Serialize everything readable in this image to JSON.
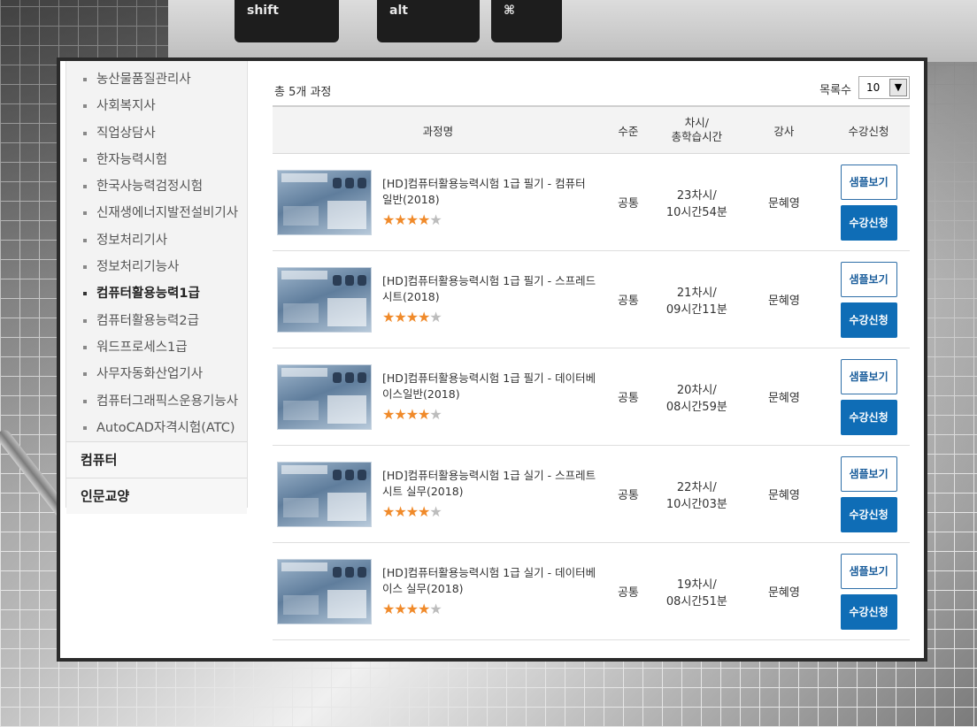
{
  "sidebar": {
    "items": [
      {
        "label": "농산물품질관리사",
        "active": false
      },
      {
        "label": "사회복지사",
        "active": false
      },
      {
        "label": "직업상담사",
        "active": false
      },
      {
        "label": "한자능력시험",
        "active": false
      },
      {
        "label": "한국사능력검정시험",
        "active": false
      },
      {
        "label": "신재생에너지발전설비기사",
        "active": false
      },
      {
        "label": "정보처리기사",
        "active": false
      },
      {
        "label": "정보처리기능사",
        "active": false
      },
      {
        "label": "컴퓨터활용능력1급",
        "active": true
      },
      {
        "label": "컴퓨터활용능력2급",
        "active": false
      },
      {
        "label": "워드프로세스1급",
        "active": false
      },
      {
        "label": "사무자동화산업기사",
        "active": false
      },
      {
        "label": "컴퓨터그래픽스운용기능사",
        "active": false
      },
      {
        "label": "AutoCAD자격시험(ATC)",
        "active": false
      }
    ],
    "categories": [
      "컴퓨터",
      "인문교양"
    ]
  },
  "main": {
    "total_text": "총 5개 과정",
    "count_label": "목록수",
    "count_value": "10",
    "columns": [
      "과정명",
      "수준",
      "차시/\n총학습시간",
      "강사",
      "수강신청"
    ],
    "courses": [
      {
        "title": "[HD]컴퓨터활용능력시험 1급 필기 - 컴퓨터 일반(2018)",
        "rating": 4.5,
        "level": "공통",
        "sessions": "23차시/",
        "duration": "10시간54분",
        "teacher": "문혜영"
      },
      {
        "title": "[HD]컴퓨터활용능력시험 1급 필기 - 스프레드시트(2018)",
        "rating": 4.5,
        "level": "공통",
        "sessions": "21차시/",
        "duration": "09시간11분",
        "teacher": "문혜영"
      },
      {
        "title": "[HD]컴퓨터활용능력시험 1급 필기 - 데이터베이스일반(2018)",
        "rating": 4.5,
        "level": "공통",
        "sessions": "20차시/",
        "duration": "08시간59분",
        "teacher": "문혜영"
      },
      {
        "title": "[HD]컴퓨터활용능력시험 1급 실기 - 스프레트시트 실무(2018)",
        "rating": 4.5,
        "level": "공통",
        "sessions": "22차시/",
        "duration": "10시간03분",
        "teacher": "문혜영"
      },
      {
        "title": "[HD]컴퓨터활용능력시험 1급 실기 - 데이터베이스 실무(2018)",
        "rating": 4.5,
        "level": "공통",
        "sessions": "19차시/",
        "duration": "08시간51분",
        "teacher": "문혜영"
      }
    ],
    "sample_label": "샘플보기",
    "enroll_label": "수강신청"
  },
  "background": {
    "keys": [
      "shift",
      "alt",
      "⌘"
    ]
  },
  "colors": {
    "enroll_button": "#0f6db6",
    "star": "#f08a2a"
  }
}
